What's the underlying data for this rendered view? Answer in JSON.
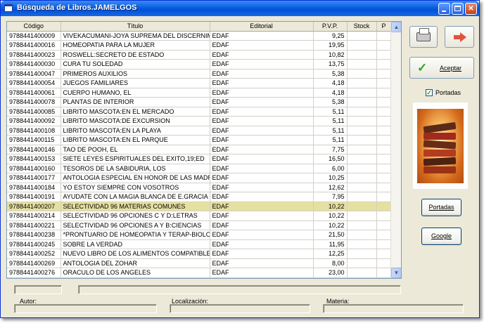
{
  "window": {
    "title": "Búsqueda de Libros.JAMELGOS"
  },
  "grid": {
    "columns": [
      "Código",
      "Título",
      "Editorial",
      "P.V.P.",
      "Stock",
      "P"
    ],
    "selected_index": 18,
    "rows": [
      [
        "9788441400009",
        "VIVEKACUMANI-JOYA SUPREMA DEL DISCERNIM",
        "EDAF",
        "9,25",
        "",
        ""
      ],
      [
        "9788441400016",
        "HOMEOPATIA PARA LA MUJER",
        "EDAF",
        "19,95",
        "",
        ""
      ],
      [
        "9788441400023",
        "ROSWELL:SECRETO DE ESTADO",
        "EDAF",
        "10,82",
        "",
        ""
      ],
      [
        "9788441400030",
        "CURA TU SOLEDAD",
        "EDAF",
        "13,75",
        "",
        ""
      ],
      [
        "9788441400047",
        "PRIMEROS AUXILIOS",
        "EDAF",
        "5,38",
        "",
        ""
      ],
      [
        "9788441400054",
        "JUEGOS FAMILIARES",
        "EDAF",
        "4,18",
        "",
        ""
      ],
      [
        "9788441400061",
        "CUERPO HUMANO, EL",
        "EDAF",
        "4,18",
        "",
        ""
      ],
      [
        "9788441400078",
        "PLANTAS DE INTERIOR",
        "EDAF",
        "5,38",
        "",
        ""
      ],
      [
        "9788441400085",
        "LIBRITO MASCOTA:EN EL MERCADO",
        "EDAF",
        "5,11",
        "",
        ""
      ],
      [
        "9788441400092",
        "LIBRITO MASCOTA:DE EXCURSION",
        "EDAF",
        "5,11",
        "",
        ""
      ],
      [
        "9788441400108",
        "LIBRITO MASCOTA:EN LA PLAYA",
        "EDAF",
        "5,11",
        "",
        ""
      ],
      [
        "9788441400115",
        "LIBRITO MASCOTA:EN EL PARQUE",
        "EDAF",
        "5,11",
        "",
        ""
      ],
      [
        "9788441400146",
        "TAO DE POOH, EL",
        "EDAF",
        "7,75",
        "",
        ""
      ],
      [
        "9788441400153",
        "SIETE LEYES ESPIRITUALES DEL EXITO,19;ED",
        "EDAF",
        "16,50",
        "",
        ""
      ],
      [
        "9788441400160",
        "TESOROS DE LA SABIDURIA, LOS",
        "EDAF",
        "6,00",
        "",
        ""
      ],
      [
        "9788441400177",
        "ANTOLOGIA ESPECIAL EN HONOR DE LAS MADR",
        "EDAF",
        "10,25",
        "",
        ""
      ],
      [
        "9788441400184",
        "YO ESTOY SIEMPRE CON VOSOTROS",
        "EDAF",
        "12,62",
        "",
        ""
      ],
      [
        "9788441400191",
        "AYUDATE CON LA MAGIA BLANCA DE E.GRACIA",
        "EDAF",
        "7,95",
        "",
        ""
      ],
      [
        "9788441400207",
        "SELECTIVIDAD 96 MATERIAS COMUNES",
        "EDAF",
        "10,22",
        "",
        ""
      ],
      [
        "9788441400214",
        "SELECTIVIDAD 96 OPCIONES C Y D:LETRAS",
        "EDAF",
        "10,22",
        "",
        ""
      ],
      [
        "9788441400221",
        "SELECTIVIDAD 96 OPCIONES A Y B:CIENCIAS",
        "EDAF",
        "10,22",
        "",
        ""
      ],
      [
        "9788441400238",
        "*PRONTUARIO DE HOMEOPATIA Y TERAP-BIOLOG",
        "EDAF",
        "21,50",
        "",
        ""
      ],
      [
        "9788441400245",
        "SOBRE LA VERDAD",
        "EDAF",
        "11,95",
        "",
        ""
      ],
      [
        "9788441400252",
        "NUEVO LIBRO DE LOS ALIMENTOS COMPATIBLES",
        "EDAF",
        "12,25",
        "",
        ""
      ],
      [
        "9788441400269",
        "ANTOLOGIA DEL ZOHAR",
        "EDAF",
        "8,00",
        "",
        ""
      ],
      [
        "9788441400276",
        "ORACULO DE LOS ANGELES",
        "EDAF",
        "23,00",
        "",
        ""
      ]
    ]
  },
  "toolbar": {
    "accept_label": "Aceptar"
  },
  "portadas_checkbox": {
    "label": "Portadas",
    "checked": true
  },
  "buttons": {
    "portadas_label": "Portadas",
    "google_label": "Google"
  },
  "footer": {
    "autor_label": "Autor:",
    "localizacion_label": "Localización:",
    "materia_label": "Materia:"
  },
  "colors": {
    "selected_row": "#e5e0a0",
    "title_bar": "#0a5ee0",
    "window_bg": "#ece9d8",
    "accept_check": "#2ea42e",
    "exit_arrow": "#e0523e"
  }
}
